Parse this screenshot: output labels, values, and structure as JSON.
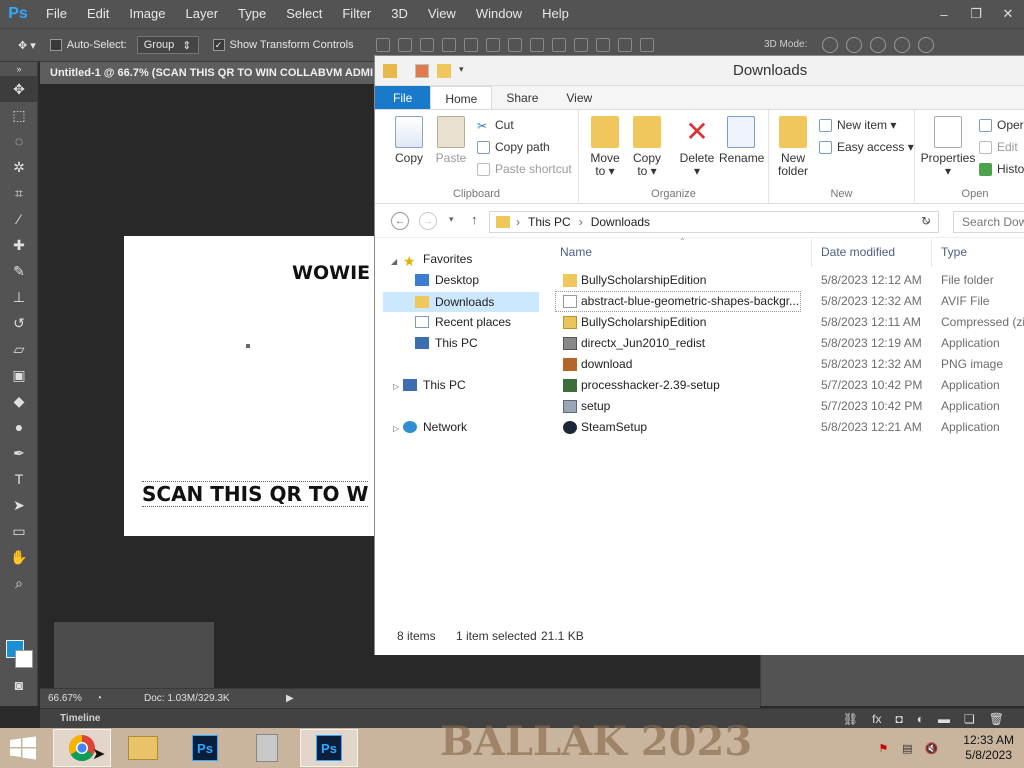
{
  "photoshop": {
    "logo": "Ps",
    "menu": [
      "File",
      "Edit",
      "Image",
      "Layer",
      "Type",
      "Select",
      "Filter",
      "3D",
      "View",
      "Window",
      "Help"
    ],
    "window_controls": [
      "–",
      "❐",
      "✕"
    ],
    "options": {
      "auto_select_label": "Auto-Select:",
      "auto_select_value": "Group",
      "show_transform_label": "Show Transform Controls",
      "mode_3d_label": "3D Mode:"
    },
    "document_tab": "Untitled-1 @ 66.7% (SCAN THIS QR TO WIN COLLABVM ADMI",
    "canvas": {
      "text_top": "WOWIE",
      "text_bottom": "SCAN THIS QR TO W"
    },
    "status": {
      "zoom": "66.67%",
      "doc_info": "Doc: 1.03M/329.3K"
    },
    "timeline_label": "Timeline",
    "colors": {
      "foreground": "#1b8fd6",
      "background": "#ffffff"
    }
  },
  "explorer": {
    "title": "Downloads",
    "tabs": [
      "File",
      "Home",
      "Share",
      "View"
    ],
    "ribbon": {
      "clipboard": {
        "label": "Clipboard",
        "copy": "Copy",
        "paste": "Paste",
        "cut": "Cut",
        "copy_path": "Copy path",
        "paste_shortcut": "Paste shortcut"
      },
      "organize": {
        "label": "Organize",
        "move_to_line1": "Move",
        "move_to_line2": "to ▾",
        "copy_to_line1": "Copy",
        "copy_to_line2": "to ▾",
        "delete_line1": "Delete",
        "delete_line2": "▾",
        "rename": "Rename"
      },
      "new": {
        "label": "New",
        "new_folder_line1": "New",
        "new_folder_line2": "folder",
        "new_item": "New item ▾",
        "easy_access": "Easy access ▾"
      },
      "open": {
        "label": "Open",
        "properties": "Properties",
        "properties_arrow": "▾",
        "open": "Oper",
        "edit": "Edit",
        "history": "Histo"
      }
    },
    "address": {
      "path": [
        "This PC",
        "Downloads"
      ],
      "search_placeholder": "Search Dow"
    },
    "nav_pane": {
      "favorites": "Favorites",
      "favorites_items": [
        "Desktop",
        "Downloads",
        "Recent places",
        "This PC"
      ],
      "this_pc": "This PC",
      "network": "Network"
    },
    "columns": {
      "name": "Name",
      "date": "Date modified",
      "type": "Type"
    },
    "files": [
      {
        "name": "BullyScholarshipEdition",
        "date": "5/8/2023 12:12 AM",
        "type": "File folder"
      },
      {
        "name": "abstract-blue-geometric-shapes-backgr...",
        "date": "5/8/2023 12:32 AM",
        "type": "AVIF File"
      },
      {
        "name": "BullyScholarshipEdition",
        "date": "5/8/2023 12:11 AM",
        "type": "Compressed (zip"
      },
      {
        "name": "directx_Jun2010_redist",
        "date": "5/8/2023 12:19 AM",
        "type": "Application"
      },
      {
        "name": "download",
        "date": "5/8/2023 12:32 AM",
        "type": "PNG image"
      },
      {
        "name": "processhacker-2.39-setup",
        "date": "5/7/2023 10:42 PM",
        "type": "Application"
      },
      {
        "name": "setup",
        "date": "5/7/2023 10:42 PM",
        "type": "Application"
      },
      {
        "name": "SteamSetup",
        "date": "5/8/2023 12:21 AM",
        "type": "Application"
      }
    ],
    "status": {
      "count": "8 items",
      "selection": "1 item selected",
      "size": "21.1 KB"
    }
  },
  "taskbar": {
    "watermark": "BALLAK 2023",
    "ps_label": "Ps",
    "clock_time": "12:33 AM",
    "clock_date": "5/8/2023"
  }
}
